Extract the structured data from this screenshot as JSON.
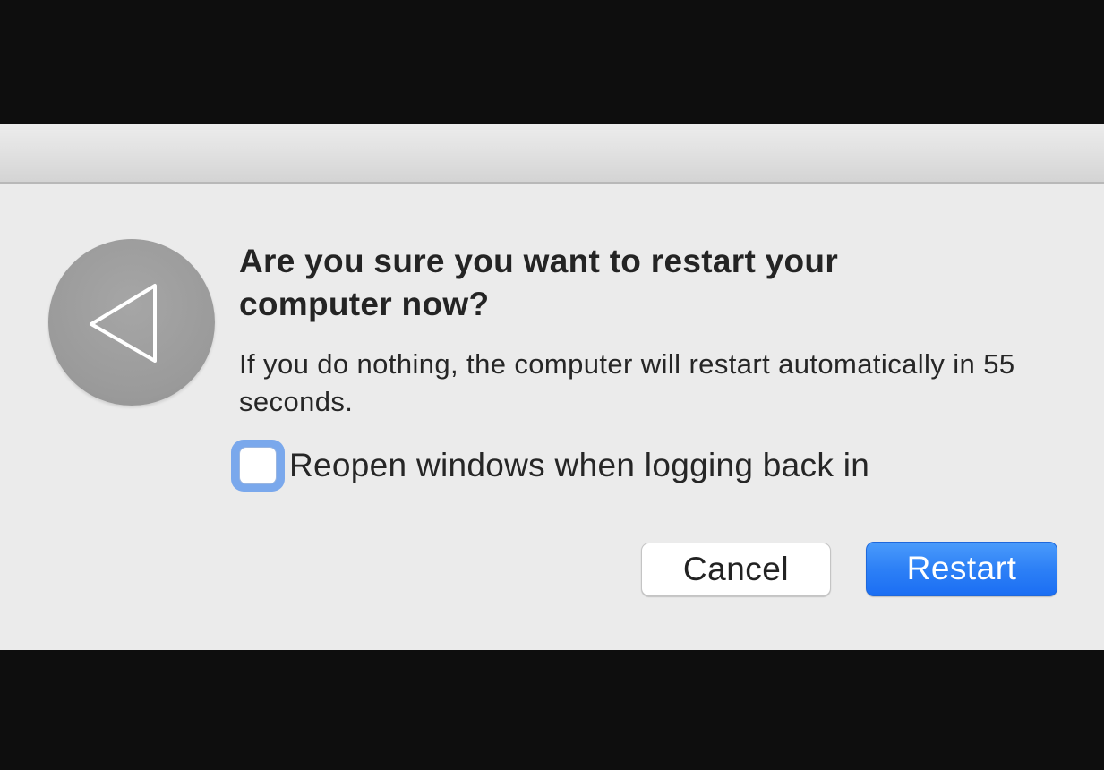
{
  "dialog": {
    "title": "Are you sure you want to restart your computer now?",
    "informative_text": "If you do nothing, the computer will restart automatically in 55 seconds.",
    "checkbox": {
      "label": "Reopen windows when logging back in",
      "checked": false
    },
    "buttons": {
      "cancel_label": "Cancel",
      "restart_label": "Restart"
    },
    "icon": "restart-triangle-icon"
  },
  "colors": {
    "dialog_background": "#ebebeb",
    "primary_button": "#1b6ef3",
    "focus_ring": "#7aa8ec",
    "icon_circle": "#9a9a9a"
  }
}
